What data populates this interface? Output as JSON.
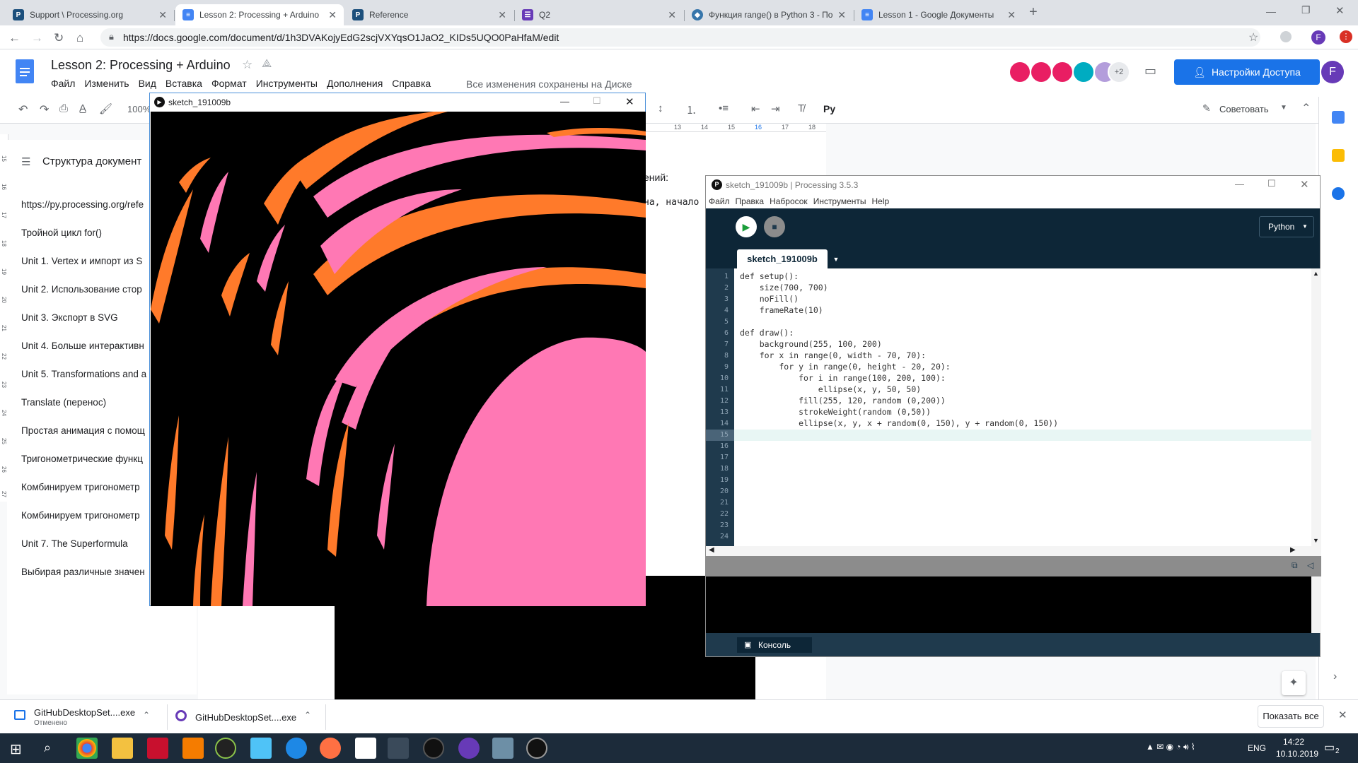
{
  "browser": {
    "tabs": [
      {
        "title": "Support \\ Processing.org",
        "icon": "P"
      },
      {
        "title": "Lesson 2: Processing + Arduino",
        "icon": "doc"
      },
      {
        "title": "Reference",
        "icon": "P"
      },
      {
        "title": "Q2",
        "icon": "form"
      },
      {
        "title": "Функция range() в Python 3 - По",
        "icon": "python"
      },
      {
        "title": "Lesson 1 - Google Документы",
        "icon": "doc"
      }
    ],
    "url": "https://docs.google.com/document/d/1h3DVAKojyEdG2scjVXYqsO1JaO2_KIDs5UQO0PaHfaM/edit",
    "profile_initial": "F"
  },
  "docs": {
    "title": "Lesson 2: Processing + Arduino",
    "menu": [
      "Файл",
      "Изменить",
      "Вид",
      "Вставка",
      "Формат",
      "Инструменты",
      "Дополнения",
      "Справка"
    ],
    "saved_status": "Все изменения сохранены на Диске",
    "share_label": "Настройки Доступа",
    "extra_collaborators": "+2",
    "user_initial": "F",
    "zoom": "100%",
    "style_label": "Pу",
    "suggest_label": "Советовать",
    "ruler_numbers": [
      "13",
      "14",
      "15",
      "16",
      "17",
      "18"
    ],
    "vruler_numbers": [
      "15",
      "16",
      "17",
      "18",
      "19",
      "20",
      "21",
      "22",
      "23",
      "24",
      "25",
      "26",
      "27"
    ],
    "outline_title": "Структура документ",
    "outline_items": [
      "https://py.processing.org/refe",
      "Тройной цикл for()",
      "Unit 1. Vertex и импорт из S",
      "Unit 2. Использование стор",
      "Unit 3. Экспорт в SVG",
      "Unit 4. Больше интерактивн",
      "Unit 5. Transformations and a",
      "Translate (перенос)",
      "Простая анимация с помощ",
      "Тригонометрические функц",
      "Комбинируем тригонометр",
      "Комбинируем тригонометр",
      "Unit 7. The Superformula",
      "Выбирая различные значен"
    ],
    "doc_text_1": "ений:",
    "doc_text_2": "на, начало"
  },
  "sketch": {
    "title": "sketch_191009b"
  },
  "ide": {
    "title": "sketch_191009b | Processing 3.5.3",
    "menu": [
      "Файл",
      "Правка",
      "Набросок",
      "Инструменты",
      "Help"
    ],
    "mode": "Python",
    "tab": "sketch_191009b",
    "console_label": "Консоль",
    "code_lines": [
      "def setup():",
      "    size(700, 700)",
      "    noFill()",
      "    frameRate(10)",
      "",
      "def draw():",
      "    background(255, 100, 200)",
      "    for x in range(0, width - 70, 70):",
      "        for y in range(0, height - 20, 20):",
      "            for i in range(100, 200, 100):",
      "                ellipse(x, y, 50, 50)",
      "            fill(255, 120, random (0,200))",
      "            strokeWeight(random (0,50))",
      "            ellipse(x, y, x + random(0, 150), y + random(0, 150))",
      ""
    ],
    "line_count": 24,
    "active_line": 15
  },
  "downloads": {
    "items": [
      {
        "name": "GitHubDesktopSet....exe",
        "status": "Отменено"
      },
      {
        "name": "GitHubDesktopSet....exe",
        "status": ""
      }
    ],
    "show_all": "Показать все"
  },
  "taskbar": {
    "lang": "ENG",
    "time": "14:22",
    "date": "10.10.2019",
    "notif": "2"
  },
  "colors": {
    "share_blue": "#1a73e8",
    "processing_dark": "#0d2637",
    "sketch_orange": "#ff7a2a",
    "sketch_pink": "#ff78b4"
  }
}
